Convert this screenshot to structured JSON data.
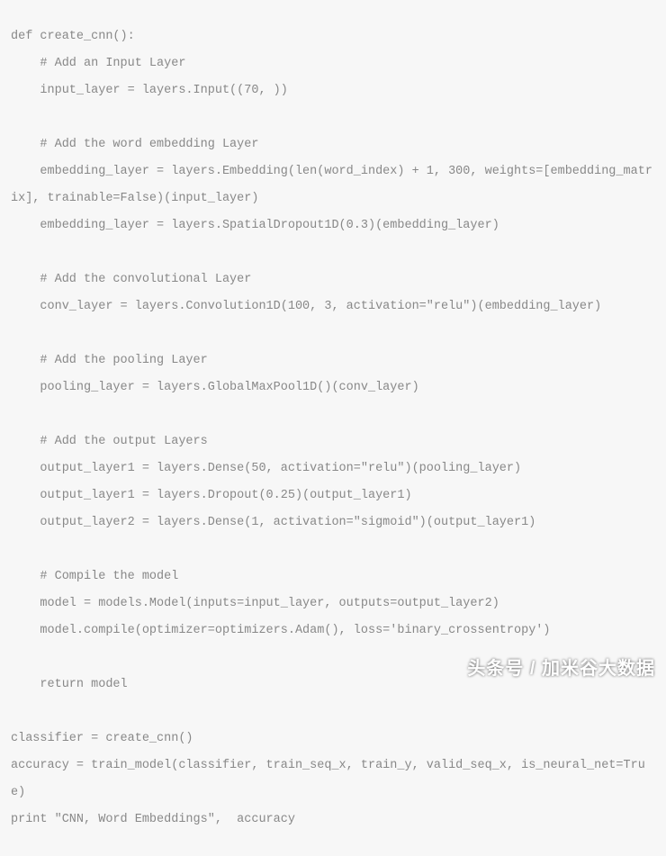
{
  "code": {
    "lines": [
      "def create_cnn():",
      "    # Add an Input Layer",
      "    input_layer = layers.Input((70, ))",
      "",
      "    # Add the word embedding Layer",
      "    embedding_layer = layers.Embedding(len(word_index) + 1, 300, weights=[embedding_matrix], trainable=False)(input_layer)",
      "    embedding_layer = layers.SpatialDropout1D(0.3)(embedding_layer)",
      "",
      "    # Add the convolutional Layer",
      "    conv_layer = layers.Convolution1D(100, 3, activation=\"relu\")(embedding_layer)",
      "",
      "    # Add the pooling Layer",
      "    pooling_layer = layers.GlobalMaxPool1D()(conv_layer)",
      "",
      "    # Add the output Layers",
      "    output_layer1 = layers.Dense(50, activation=\"relu\")(pooling_layer)",
      "    output_layer1 = layers.Dropout(0.25)(output_layer1)",
      "    output_layer2 = layers.Dense(1, activation=\"sigmoid\")(output_layer1)",
      "",
      "    # Compile the model",
      "    model = models.Model(inputs=input_layer, outputs=output_layer2)",
      "    model.compile(optimizer=optimizers.Adam(), loss='binary_crossentropy')",
      "",
      "    return model",
      "",
      "classifier = create_cnn()",
      "accuracy = train_model(classifier, train_seq_x, train_y, valid_seq_x, is_neural_net=True)",
      "print \"CNN, Word Embeddings\",  accuracy"
    ]
  },
  "watermark": "头条号 / 加米谷大数据"
}
